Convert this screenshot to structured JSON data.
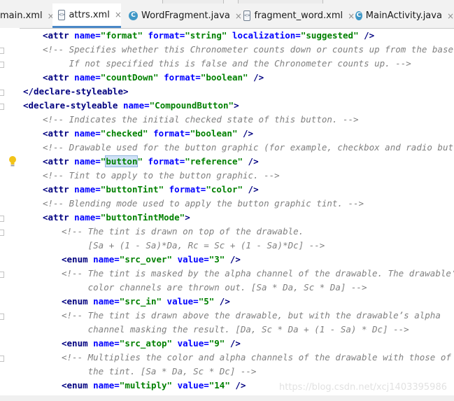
{
  "tabs": [
    {
      "label": "main.xml",
      "icon": "xml-file-icon",
      "active": false
    },
    {
      "label": "attrs.xml",
      "icon": "xml-file-icon",
      "active": true
    },
    {
      "label": "WordFragment.java",
      "icon": "java-class-icon",
      "active": false
    },
    {
      "label": "fragment_word.xml",
      "icon": "xml-file-icon",
      "active": false
    },
    {
      "label": "MainActivity.java",
      "icon": "java-class-icon",
      "active": false
    }
  ],
  "close_glyph": "×",
  "icon_xml_text": "<>",
  "icon_java_text": "C",
  "colors": {
    "tag": "#000080",
    "attribute": "#0000ff",
    "value": "#008000",
    "comment": "#808080",
    "selection": "#cfe2f6",
    "active_tab_underline": "#4a88c7"
  },
  "code": {
    "l1": {
      "a": "<attr ",
      "b": "name=",
      "c": "\"format\"",
      "d": " ",
      "e": "format=",
      "f": "\"string\"",
      "g": " ",
      "h": "localization=",
      "i": "\"suggested\"",
      "j": " />"
    },
    "l2": {
      "a": "<!-- Specifies whether this Chronometer counts down or counts up from the base."
    },
    "l3": {
      "a": "     If not specified this is false and the Chronometer counts up. -->"
    },
    "l4": {
      "a": "<attr ",
      "b": "name=",
      "c": "\"countDown\"",
      "d": " ",
      "e": "format=",
      "f": "\"boolean\"",
      "j": " />"
    },
    "l5": {
      "a": "</declare-styleable>"
    },
    "l6": {
      "a": "<declare-styleable ",
      "b": "name=",
      "c": "\"CompoundButton\"",
      "j": ">"
    },
    "l7": {
      "a": "<!-- Indicates the initial checked state of this button. -->"
    },
    "l8": {
      "a": "<attr ",
      "b": "name=",
      "c": "\"checked\"",
      "d": " ",
      "e": "format=",
      "f": "\"boolean\"",
      "j": " />"
    },
    "l9": {
      "a": "<!-- Drawable used for the button graphic (for example, checkbox and radio button). -->"
    },
    "l10": {
      "a": "<attr ",
      "b": "name=",
      "q1": "\"",
      "sel": "button",
      "q2": "\"",
      "d": " ",
      "e": "format=",
      "f": "\"reference\"",
      "j": " />"
    },
    "l11": {
      "a": "<!-- Tint to apply to the button graphic. -->"
    },
    "l12": {
      "a": "<attr ",
      "b": "name=",
      "c": "\"buttonTint\"",
      "d": " ",
      "e": "format=",
      "f": "\"color\"",
      "j": " />"
    },
    "l13": {
      "a": "<!-- Blending mode used to apply the button graphic tint. -->"
    },
    "l14": {
      "a": "<attr ",
      "b": "name=",
      "c": "\"buttonTintMode\"",
      "j": ">"
    },
    "l15": {
      "a": "<!-- The tint is drawn on top of the drawable."
    },
    "l16": {
      "a": "     [Sa + (1 - Sa)*Da, Rc = Sc + (1 - Sa)*Dc] -->"
    },
    "l17": {
      "a": "<enum ",
      "b": "name=",
      "c": "\"src_over\"",
      "d": " ",
      "e": "value=",
      "f": "\"3\"",
      "j": " />"
    },
    "l18": {
      "a": "<!-- The tint is masked by the alpha channel of the drawable. The drawable’s"
    },
    "l19": {
      "a": "     color channels are thrown out. [Sa * Da, Sc * Da] -->"
    },
    "l20": {
      "a": "<enum ",
      "b": "name=",
      "c": "\"src_in\"",
      "d": " ",
      "e": "value=",
      "f": "\"5\"",
      "j": " />"
    },
    "l21": {
      "a": "<!-- The tint is drawn above the drawable, but with the drawable’s alpha"
    },
    "l22": {
      "a": "     channel masking the result. [Da, Sc * Da + (1 - Sa) * Dc] -->"
    },
    "l23": {
      "a": "<enum ",
      "b": "name=",
      "c": "\"src_atop\"",
      "d": " ",
      "e": "value=",
      "f": "\"9\"",
      "j": " />"
    },
    "l24": {
      "a": "<!-- Multiplies the color and alpha channels of the drawable with those of"
    },
    "l25": {
      "a": "     the tint. [Sa * Da, Sc * Dc] -->"
    },
    "l26": {
      "a": "<enum ",
      "b": "name=",
      "c": "\"multiply\"",
      "d": " ",
      "e": "value=",
      "f": "\"14\"",
      "j": " />"
    }
  },
  "watermark": "https://blog.csdn.net/xcj1403395986"
}
